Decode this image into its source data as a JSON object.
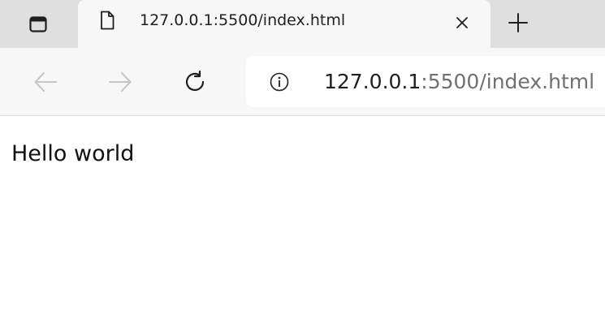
{
  "browser": {
    "tab": {
      "title": "127.0.0.1:5500/index.html",
      "close_icon": "close-icon",
      "page_icon": "document-icon"
    },
    "tab_actions_icon": "tab-actions-icon",
    "new_tab_icon": "plus-icon",
    "toolbar": {
      "back_icon": "arrow-left-icon",
      "forward_icon": "arrow-right-icon",
      "reload_icon": "reload-icon",
      "site_info_icon": "info-icon"
    },
    "address": {
      "host": "127.0.0.1",
      "rest": ":5500/index.html"
    }
  },
  "page": {
    "text": "Hello world"
  }
}
